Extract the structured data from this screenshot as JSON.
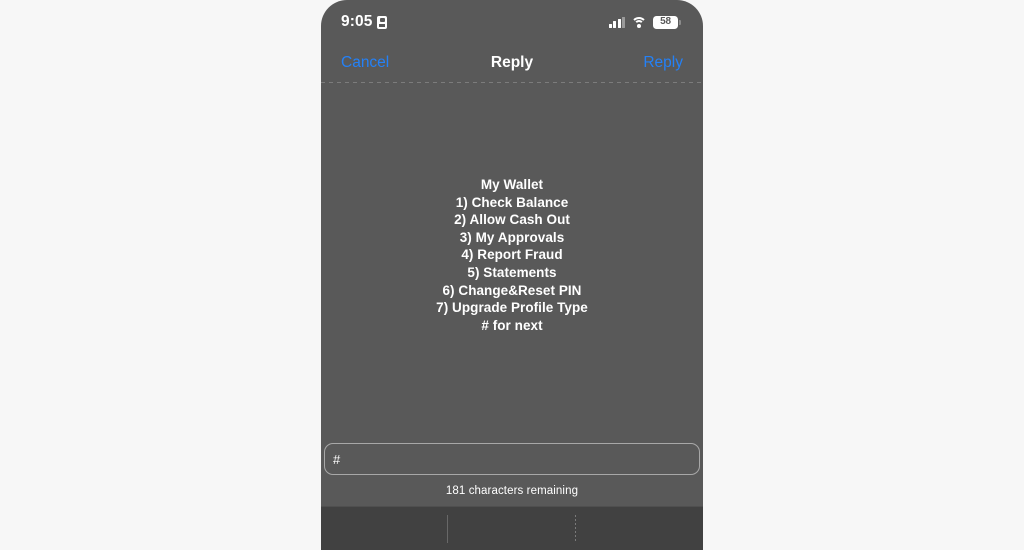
{
  "status_bar": {
    "time": "9:05",
    "time_badge_icon": "id-card-icon",
    "signal_icon": "cellular-signal-icon",
    "signal_bars_filled": 3,
    "signal_bars_total": 4,
    "wifi_icon": "wifi-icon",
    "battery_icon": "battery-icon",
    "battery_percent": "58"
  },
  "nav_bar": {
    "cancel_label": "Cancel",
    "title": "Reply",
    "reply_label": "Reply",
    "accent_color": "#2481f7"
  },
  "message": {
    "body": "My Wallet\n1) Check Balance\n2) Allow Cash Out\n3) My Approvals\n4) Report Fraud\n5) Statements\n6) Change&Reset PIN\n7) Upgrade Profile Type\n# for next",
    "lines": [
      "My Wallet",
      "1) Check Balance",
      "2) Allow Cash Out",
      "3) My Approvals",
      "4) Report Fraud",
      "5) Statements",
      "6) Change&Reset PIN",
      "7) Upgrade Profile Type",
      "# for next"
    ]
  },
  "reply_input": {
    "value": "#",
    "placeholder": ""
  },
  "char_counter": {
    "text": "181 characters remaining"
  },
  "colors": {
    "page_background": "#f7f7f7",
    "screen_background": "#595959",
    "keyboard_background": "#414141",
    "text": "#ffffff",
    "accent": "#2481f7"
  }
}
